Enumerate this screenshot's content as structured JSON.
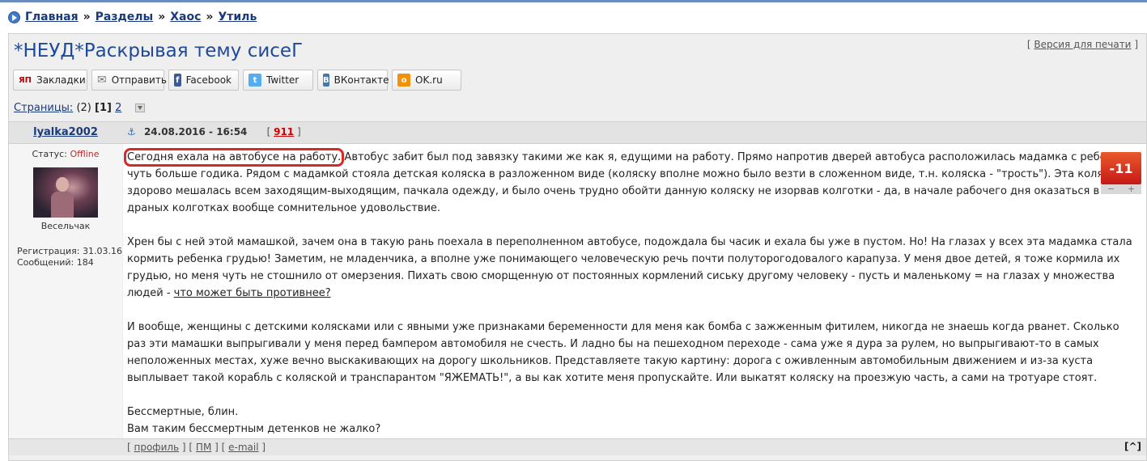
{
  "breadcrumb": {
    "items": [
      "Главная",
      "Разделы",
      "Хаос",
      "Утиль"
    ],
    "separator": "»"
  },
  "topic": {
    "title": "*НЕУД*Раскрывая тему сисеГ",
    "print_open": "[",
    "print_label": "Версия для печати",
    "print_close": "]"
  },
  "share": [
    {
      "label": "Закладки",
      "icon": "yandex-bookmarks-icon",
      "glyph": "ЯП",
      "color": "#c00000"
    },
    {
      "label": "Отправить",
      "icon": "mail-icon",
      "glyph": "✉",
      "color": "#888888"
    },
    {
      "label": "Facebook",
      "icon": "facebook-icon",
      "glyph": "f",
      "color": "#3b5998"
    },
    {
      "label": "Twitter",
      "icon": "twitter-icon",
      "glyph": "t",
      "color": "#55acee"
    },
    {
      "label": "ВКонтакте",
      "icon": "vk-icon",
      "glyph": "В",
      "color": "#4a76a8"
    },
    {
      "label": "OK.ru",
      "icon": "ok-icon",
      "glyph": "о",
      "color": "#f2910a"
    }
  ],
  "pagination": {
    "label": "Страницы:",
    "count": "(2)",
    "current": "[1]",
    "next": "2"
  },
  "post": {
    "author": "lyalka2002",
    "date": "24.08.2016 - 16:54",
    "num_open": "[",
    "num": "911",
    "num_close": "]",
    "status_label": "Статус:",
    "status_value": "Offline",
    "rank": "Весельчак",
    "reg": "Регистрация: 31.03.16",
    "messages": "Сообщений: 184",
    "rating": "-11",
    "rating_minus": "−",
    "rating_plus": "+",
    "p1_lead": "Сегодня ехала на автобусе на работу.",
    "p1_rest": " Автобус забит был под завязку такими же как я, едущими на работу. Прямо напротив дверей автобуса расположилась мадамка с ребенком, чуть больше годика. Рядом с мадамкой стояла детская коляска в разложенном виде (коляску вполне можно было везти в сложенном виде, т.н. коляска - \"трость\"). Эта коляска здорово мешалась всем заходящим-выходящим, пачкала одежду, и было очень трудно обойти данную коляску не изорвав колготки - да, в начале рабочего дня оказаться в драных колготках вообще сомнительное удовольствие.",
    "p2": "Хрен бы с ней этой мамашкой, зачем она в такую рань поехала в переполненном автобусе, подождала бы часик и ехала бы уже в пустом. Но! На глазах у всех эта мадамка стала кормить ребенка грудью! Заметим, не младенчика, а вполне уже понимающего человеческую речь почти полуторогодовалого карапуза. У меня двое детей, я тоже кормила их грудью, но меня чуть не стошнило от омерзения. Пихать свою сморщенную от постоянных кормлений сиську другому человеку - пусть и маленькому = на глазах у множества людей - ",
    "p2_link": "что может быть противнее?",
    "p3": "И вообще, женщины с детскими колясками или с явными уже признаками беременности для меня как бомба с зажженным фитилем, никогда не знаешь когда рванет. Сколько раз эти мамашки выпрыгивали у меня перед бампером автомобиля не счесть. И ладно бы на пешеходном переходе - сама уже я дура за рулем, но выпрыгивают-то в самых неположенных местах, хуже вечно выскакивающих на дорогу школьников. Представляете такую картину: дорога с оживленным автомобильным движением и из-за куста выплывает такой корабль с коляской и транспарантом \"ЯЖЕМАТЬ!\", а вы как хотите меня пропускайте. Или выкатят коляску на проезжую часть, а сами на тротуаре стоят.",
    "p4_line1": "Бессмертные, блин.",
    "p4_line2": "Вам таким бессмертным детенков не жалко?"
  },
  "footer": {
    "profile": "профиль",
    "pm": "ПМ",
    "email": "e-mail",
    "top": "[^]"
  }
}
